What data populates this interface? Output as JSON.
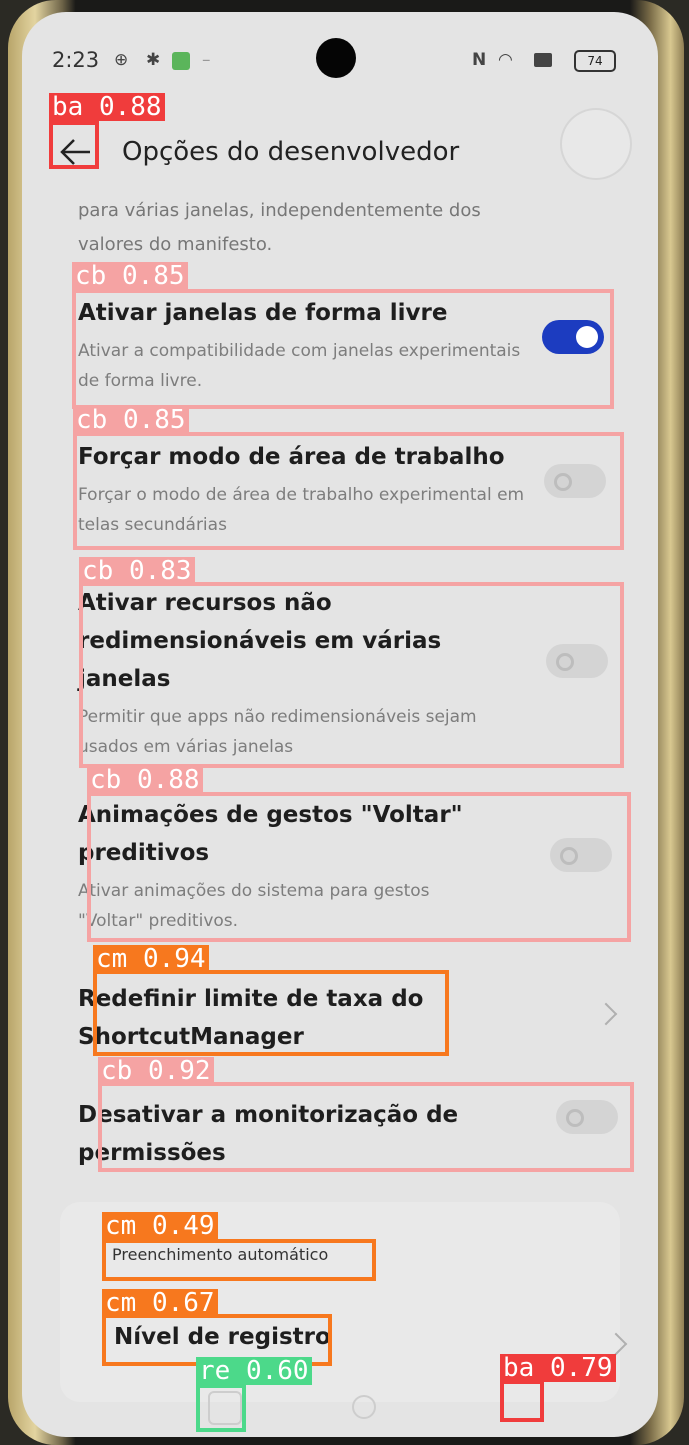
{
  "status_bar": {
    "time": "2:23",
    "battery": "74",
    "icons": [
      "vpn-icon",
      "bug-icon",
      "app-notification-icon",
      "nfc-icon",
      "wifi-icon",
      "sim-off-icon",
      "battery-icon"
    ]
  },
  "app_bar": {
    "title": "Opções do desenvolvedor",
    "back_icon": "arrow-left-icon"
  },
  "top_description": "para várias janelas, independentemente dos valores do manifesto.",
  "settings": [
    {
      "title": "Ativar janelas de forma livre",
      "desc": "Ativar a compatibilidade com janelas experimentais de forma livre.",
      "toggle": true
    },
    {
      "title": "Forçar modo de área de trabalho",
      "desc": "Forçar o modo de área de trabalho experimental em telas secundárias",
      "toggle": false
    },
    {
      "title": "Ativar recursos não redimensionáveis em várias janelas",
      "desc": "Permitir que apps não redimensionáveis sejam usados em várias janelas",
      "toggle": false
    },
    {
      "title": "Animações de gestos \"Voltar\" preditivos",
      "desc": "Ativar animações do sistema para gestos \"Voltar\" preditivos.",
      "toggle": false
    },
    {
      "title": "Redefinir limite de taxa do ShortcutManager",
      "type": "navigation"
    },
    {
      "title": "Desativar a monitorização de permissões",
      "toggle": false
    }
  ],
  "section_header": "Preenchimento automático",
  "log_level": {
    "title": "Nível de registro"
  },
  "detections": [
    {
      "label": "ba 0.88",
      "color": "#f03c3c"
    },
    {
      "label": "cb 0.85",
      "color": "#f5a3a3"
    },
    {
      "label": "cb 0.85",
      "color": "#f5a3a3"
    },
    {
      "label": "cb 0.83",
      "color": "#f5a3a3"
    },
    {
      "label": "cb 0.88",
      "color": "#f5a3a3"
    },
    {
      "label": "cm 0.94",
      "color": "#f7781e"
    },
    {
      "label": "cb 0.92",
      "color": "#f5a3a3"
    },
    {
      "label": "cm 0.49",
      "color": "#f7781e"
    },
    {
      "label": "cm 0.67",
      "color": "#f7781e"
    },
    {
      "label": "re 0.60",
      "color": "#4cd98a"
    },
    {
      "label": "ba 0.79",
      "color": "#f03c3c"
    }
  ]
}
